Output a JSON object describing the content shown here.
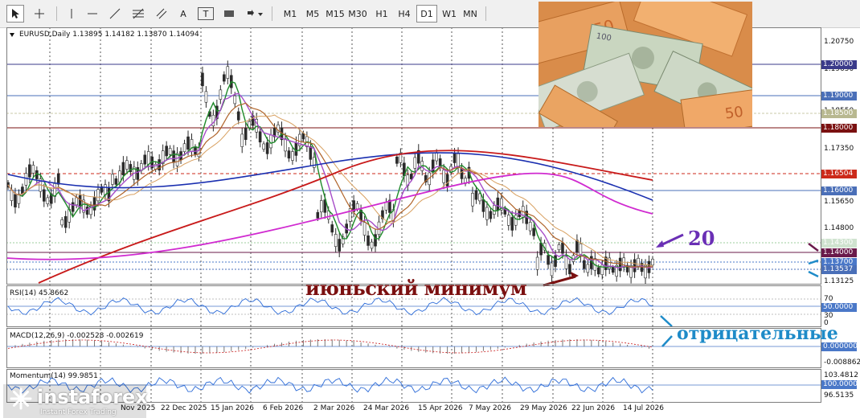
{
  "toolbar": {
    "tools": [
      "cursor",
      "crosshair",
      "vertical-line",
      "horizontal-line",
      "trendline",
      "fibonacci",
      "text",
      "text-label",
      "rectangle",
      "arrows"
    ],
    "text_tool": "A",
    "label_tool": "T",
    "timeframes": [
      "M1",
      "M5",
      "M15",
      "M30",
      "H1",
      "H4",
      "D1",
      "W1",
      "MN"
    ],
    "active_timeframe": "D1"
  },
  "chart": {
    "header": "EURUSD,Daily  1.13895 1.14182 1.13870 1.14094",
    "price_labels": [
      "1.20750",
      "1.19650",
      "1.18550",
      "1.17350",
      "1.15650",
      "1.14800",
      "1.13125"
    ],
    "tags": [
      {
        "text": "1.20000",
        "color": "#3a3a8a"
      },
      {
        "text": "1.19000",
        "color": "#4a6fb8"
      },
      {
        "text": "1.18500",
        "color": "#b8b890"
      },
      {
        "text": "1.18000",
        "color": "#7a1010"
      },
      {
        "text": "1.16504",
        "color": "#cc2a1a"
      },
      {
        "text": "1.16000",
        "color": "#4a6fb8"
      },
      {
        "text": "1.14300",
        "color": "#cfe3cf"
      },
      {
        "text": "1.14000",
        "color": "#6a1a4a"
      },
      {
        "text": "1.13700",
        "color": "#4a78c8"
      },
      {
        "text": "1.13537",
        "color": "#4a6fb8"
      }
    ],
    "dates": [
      "22 Dec 2025",
      "15 Jan 2026",
      "6 Feb 2026",
      "2 Mar 2026",
      "24 Mar 2026",
      "15 Apr 2026",
      "7 May 2026",
      "29 May 2026",
      "22 Jun 2026",
      "14 Jul 2026"
    ],
    "partial_date": "Nov 2025",
    "colors": {
      "bull": "#2a2a2a",
      "ma_green": "#1f8a2a",
      "ma_violet": "#a64cc8",
      "ma_brown": "#b0642a",
      "ma_orange": "#d8a060",
      "ma_blue": "#1a2fb0",
      "ma_red": "#c81a1a",
      "ma_magenta": "#d02ad0"
    }
  },
  "rsi": {
    "title": "RSI(14) 45.8662",
    "levels": [
      "70",
      "50",
      "30",
      "0"
    ],
    "tag": "50.0000"
  },
  "macd": {
    "title": "MACD(12,26,9) -0.002528 -0.002619",
    "tag": "0.000000",
    "low": "-0.008862"
  },
  "momentum": {
    "title": "Momentum(14) 99.9851",
    "levels": [
      "103.4812",
      "96.5135"
    ],
    "tag": "100.0000"
  },
  "annotations": {
    "june_min": "июньский минимум",
    "twenty": "20",
    "negative": "отрицательные"
  },
  "logo": {
    "brand": "instaforex",
    "tagline": "Instant Forex Trading"
  }
}
